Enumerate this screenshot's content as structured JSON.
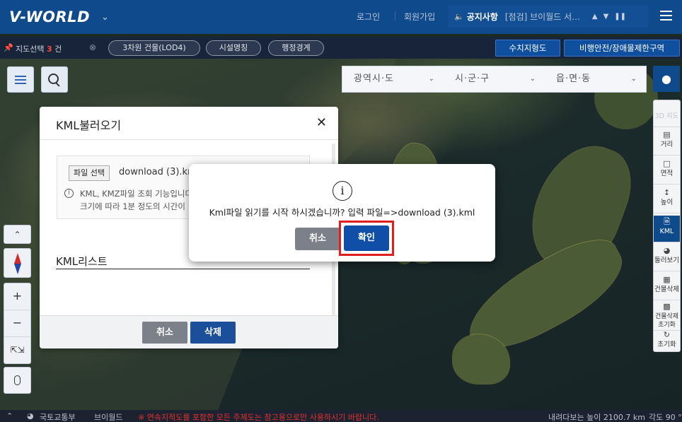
{
  "header": {
    "logo": "V-WORLD",
    "login": "로그인",
    "signup": "회원가입",
    "notice_title": "공지사항",
    "notice_text": "[점검] 브이월드 서…"
  },
  "filterbar": {
    "label_prefix": "지도선택",
    "count": "3",
    "label_suffix": "건",
    "chips": [
      "3차원 건물(LOD4)",
      "시설명칭",
      "행정경계"
    ],
    "button_dem": "수치지형도",
    "button_flight": "비행안전/장애물제한구역"
  },
  "region": {
    "sido": "광역시·도",
    "sigungu": "시·군·구",
    "eupmyeondong": "읍·면·동"
  },
  "right_toolbar": {
    "items": [
      "3D 지도",
      "거리",
      "면적",
      "높이",
      "KML",
      "둘러보기",
      "건물삭제",
      "건물삭제 초기화",
      "초기화"
    ]
  },
  "kml_panel": {
    "title": "KML불러오기",
    "file_button": "파일 선택",
    "file_name": "download (3).kml",
    "info_line1": "KML, KMZ파일 조회 기능입니다.",
    "info_line2": "크기에 따라 1분 정도의 시간이",
    "list_title": "KML리스트",
    "cancel": "취소",
    "delete": "삭제"
  },
  "dialog": {
    "icon": "i",
    "message": "Kml파일 읽기를 시작 하시겠습니까? 입력 파일=>download (3).kml",
    "cancel": "취소",
    "ok": "확인"
  },
  "statusbar": {
    "ministry": "국토교통부",
    "brand": "브이월드",
    "warning": "※ 연속지적도를 포함한 모든 주제도는 참고용으로만 사용하시기 바랍니다.",
    "altitude": "내려다보는 높이 2100.7 km",
    "angle": "각도 90 °"
  },
  "colors": {
    "header_bg": "#0e4a8c",
    "accent_red": "#e11e1e",
    "primary_button": "#0f4fa8"
  }
}
